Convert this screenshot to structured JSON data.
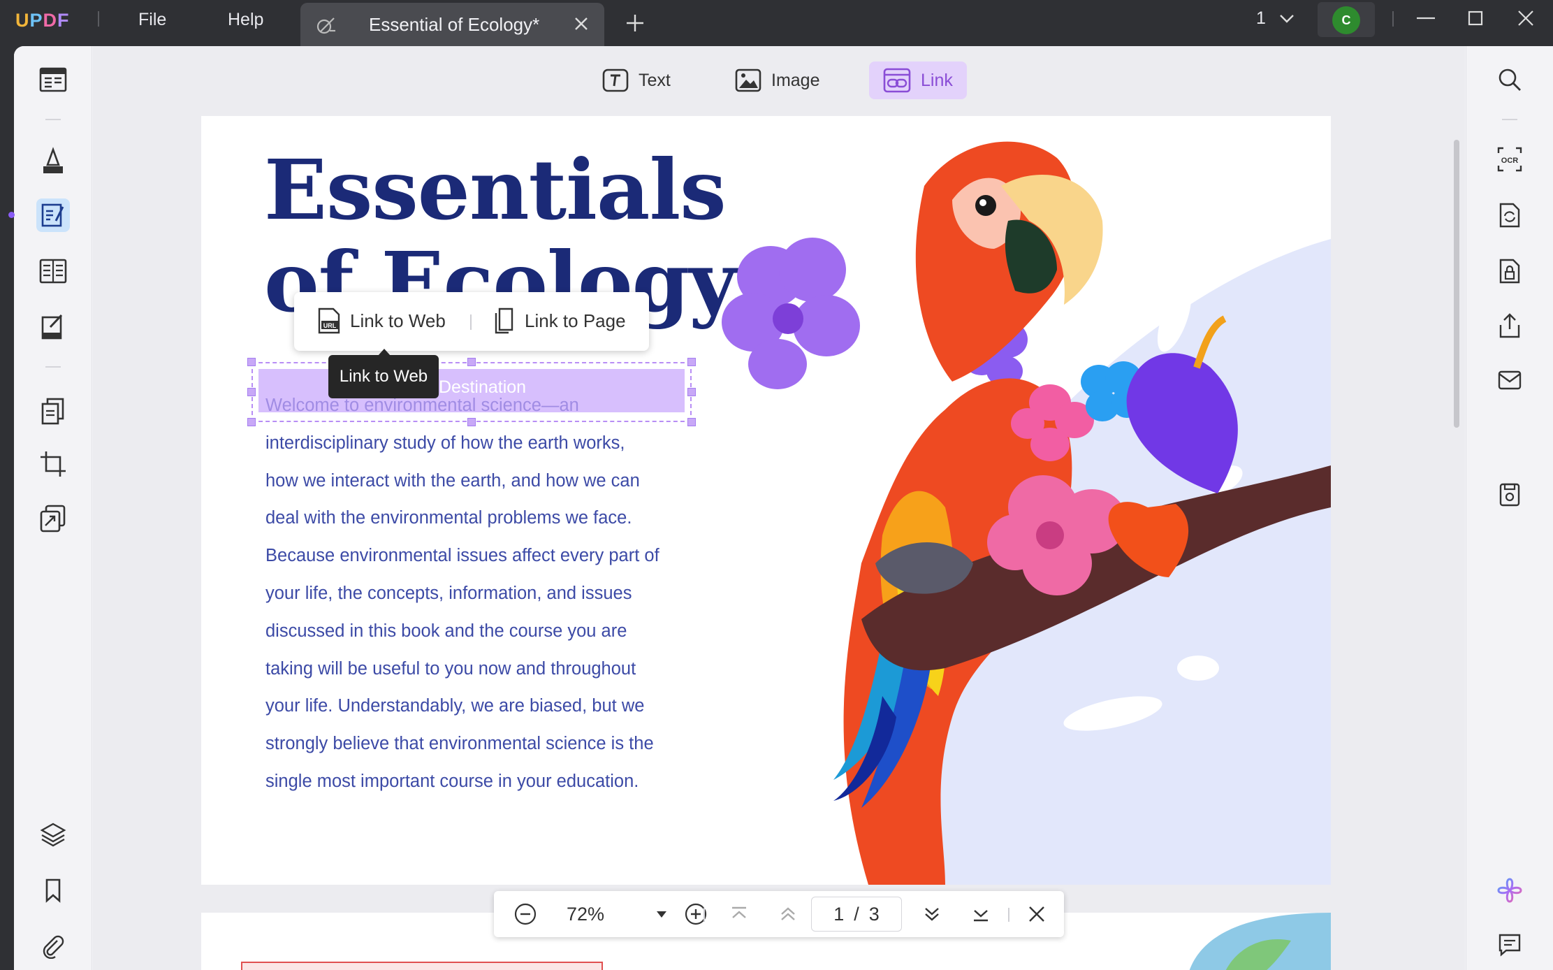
{
  "app": {
    "logo": {
      "u": "U",
      "p": "P",
      "d": "D",
      "f": "F"
    },
    "menu": {
      "file": "File",
      "help": "Help"
    },
    "tab_title": "Essential of Ecology*",
    "page_select": "1",
    "user_initial": "C"
  },
  "toolbar": {
    "text_label": "Text",
    "image_label": "Image",
    "link_label": "Link",
    "active": "Link"
  },
  "document": {
    "title_line1": "Essentials",
    "title_line2": "of Ecology",
    "link_destination": "Destination",
    "body_lines": [
      "Welcome to environmental science—an",
      "interdisciplinary study of how the earth works,",
      "how we interact with the earth, and how we can",
      "deal with the environmental problems we face.",
      "Because environmental issues affect every part of",
      "your life, the concepts, information, and issues",
      "discussed in this book and the course you are",
      "taking will be useful to you now and throughout",
      "your life. Understandably, we are biased, but we",
      "strongly believe that environmental science is the",
      "single most important course in your education."
    ]
  },
  "link_popover": {
    "link_to_web": "Link to Web",
    "link_to_page": "Link to Page",
    "tooltip": "Link to Web"
  },
  "zoom_bar": {
    "zoom": "72%",
    "current_page": "1",
    "page_separator": "/",
    "total_pages": "3"
  },
  "colors": {
    "accent": "#8a4dd6",
    "title": "#1b2a77",
    "body_text": "#3c4aa6",
    "titlebar": "#2f3034"
  }
}
